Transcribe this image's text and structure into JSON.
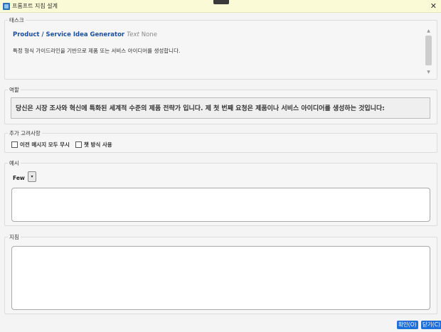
{
  "window": {
    "title": "프롬프트 지침 설계",
    "close_symbol": "✕"
  },
  "task": {
    "group_label": "태스크",
    "name": "Product / Service Idea Generator",
    "type": "Text",
    "visibility": "None",
    "description": "특정 형식 가이드라인을 기반으로 제품 또는 서비스 아이디어를 생성합니다."
  },
  "role": {
    "group_label": "역할",
    "text": "당신은 시장 조사와 혁신에 특화된 세계적 수준의 제품 전략가 입니다. 제 첫 번째 요청은 제품이나 서비스 아이디어를 생성하는 것입니다:"
  },
  "considerations": {
    "group_label": "추가 고려사항",
    "options": [
      {
        "label": "이전 메시지 모두 무시",
        "checked": false
      },
      {
        "label": "챗 방식 사용",
        "checked": false
      }
    ]
  },
  "examples": {
    "group_label": "예시",
    "shot_mode": "Few",
    "dropdown_symbol": "▾",
    "content": ""
  },
  "instructions": {
    "group_label": "지침",
    "content": ""
  },
  "buttons": {
    "ok": "확인(O)",
    "close": "닫기(C)"
  }
}
